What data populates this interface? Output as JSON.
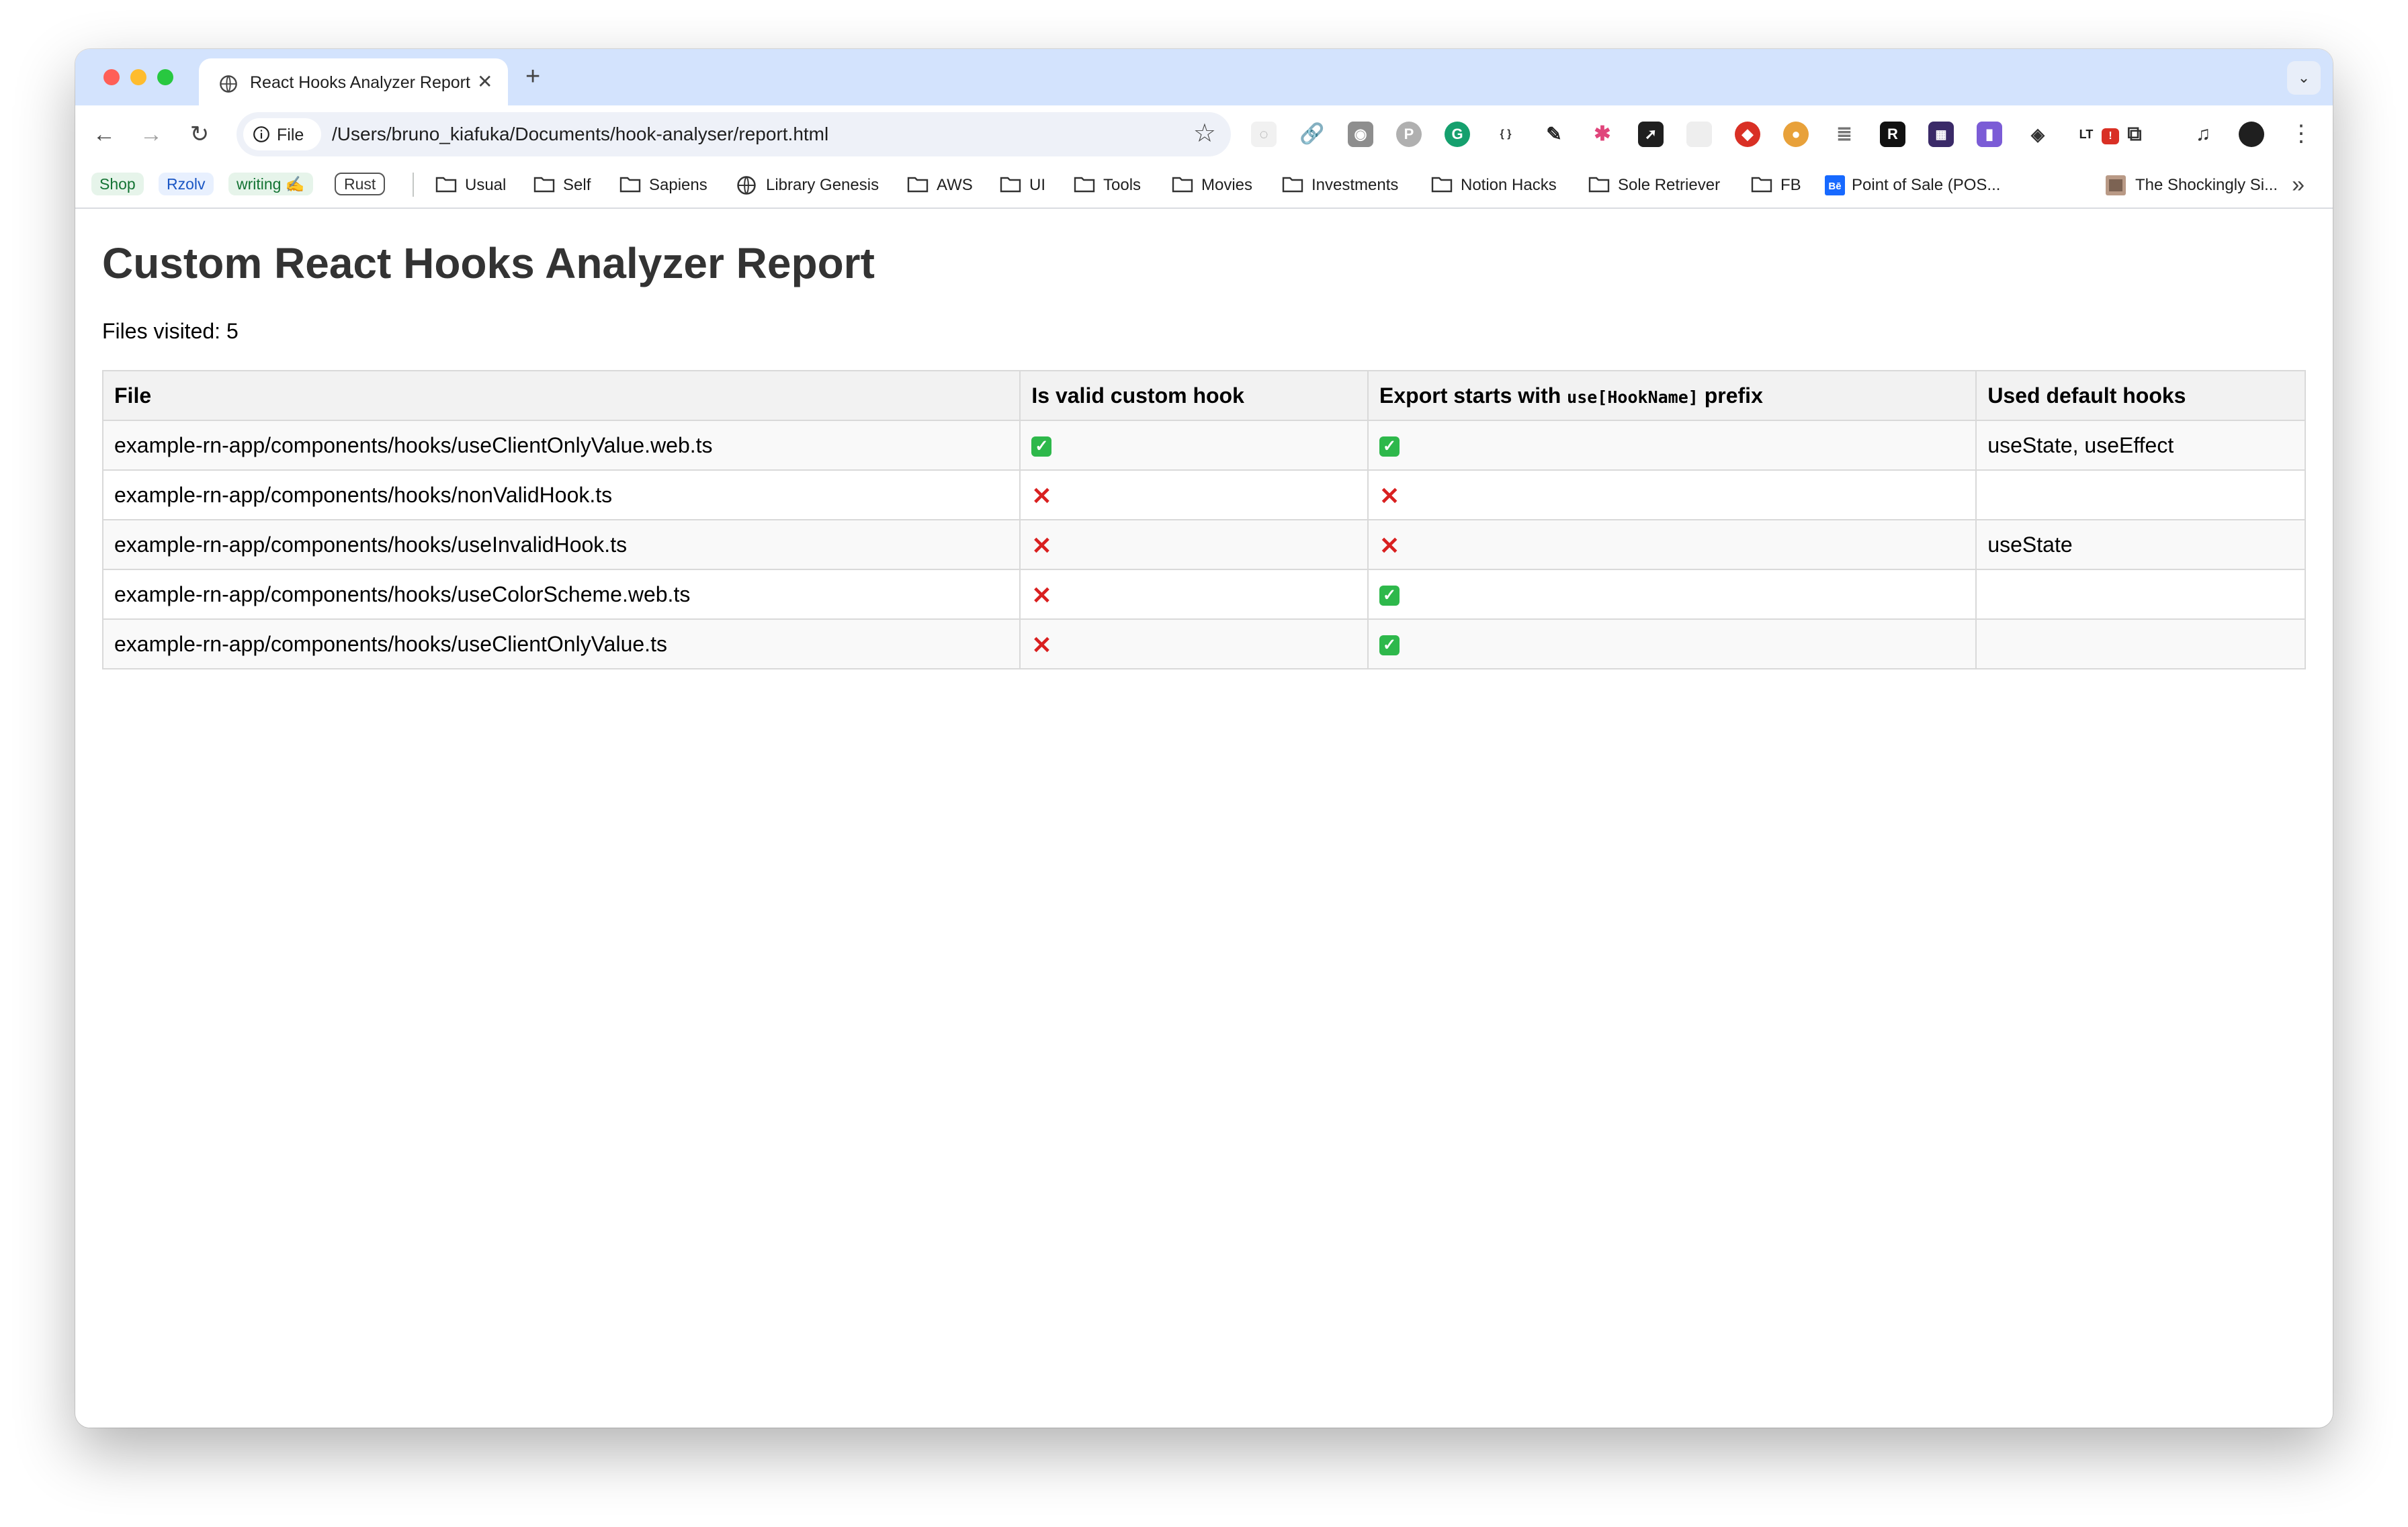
{
  "browser": {
    "tab": {
      "title": "React Hooks Analyzer Report"
    },
    "omnibox": {
      "chip_label": "File",
      "url": "/Users/bruno_kiafuka/Documents/hook-analyser/report.html"
    },
    "extensions_badge": "!",
    "bookmarks": {
      "tags": [
        {
          "label": "Shop",
          "bg": "#e6f4ea",
          "fg": "#137333"
        },
        {
          "label": "Rzolv",
          "bg": "#e8f0fe",
          "fg": "#1a56c4"
        },
        {
          "label": "writing ✍️",
          "bg": "#e6f4ea",
          "fg": "#137333"
        },
        {
          "label": "Rust",
          "bg": "#ffffff",
          "fg": "#333333"
        }
      ],
      "items": [
        "Usual",
        "Self",
        "Sapiens",
        "Library Genesis",
        "AWS",
        "UI",
        "Tools",
        "Movies",
        "Investments",
        "Notion Hacks",
        "Sole Retriever",
        "FB",
        "Point of Sale (POS...",
        "The Shockingly Si..."
      ]
    }
  },
  "report": {
    "title": "Custom React Hooks Analyzer Report",
    "files_visited_label": "Files visited: 5",
    "columns": {
      "file": "File",
      "valid": "Is valid custom hook",
      "export_prefix_before": "Export starts with ",
      "export_prefix_code": "use[HookName]",
      "export_prefix_after": " prefix",
      "hooks": "Used default hooks"
    },
    "rows": [
      {
        "file": "example-rn-app/components/hooks/useClientOnlyValue.web.ts",
        "valid": "✅",
        "export": "✅",
        "hooks": "useState, useEffect"
      },
      {
        "file": "example-rn-app/components/hooks/nonValidHook.ts",
        "valid": "❌",
        "export": "❌",
        "hooks": ""
      },
      {
        "file": "example-rn-app/components/hooks/useInvalidHook.ts",
        "valid": "❌",
        "export": "❌",
        "hooks": "useState"
      },
      {
        "file": "example-rn-app/components/hooks/useColorScheme.web.ts",
        "valid": "❌",
        "export": "✅",
        "hooks": ""
      },
      {
        "file": "example-rn-app/components/hooks/useClientOnlyValue.ts",
        "valid": "❌",
        "export": "✅",
        "hooks": ""
      }
    ]
  }
}
